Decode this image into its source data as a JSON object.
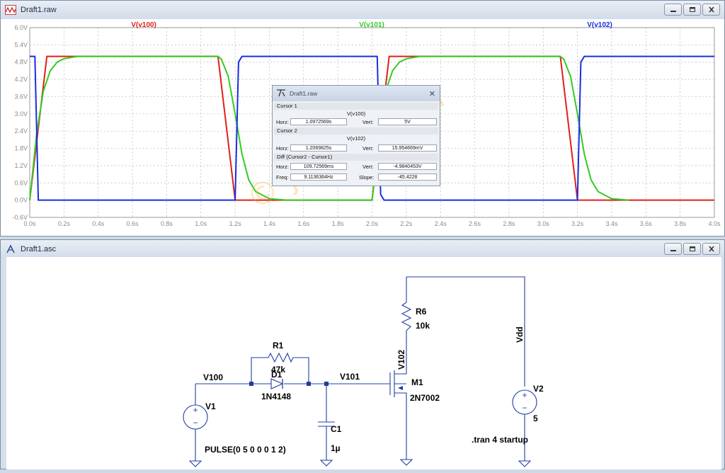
{
  "top_window": {
    "title": "Draft1.raw"
  },
  "bottom_window": {
    "title": "Draft1.asc"
  },
  "plot": {
    "trace_labels": [
      {
        "name": "V(v100)",
        "color": "#e0201a"
      },
      {
        "name": "V(v101)",
        "color": "#33cc22"
      },
      {
        "name": "V(v102)",
        "color": "#1a2de0"
      }
    ],
    "y_ticks": [
      "6.0V",
      "5.4V",
      "4.8V",
      "4.2V",
      "3.6V",
      "3.0V",
      "2.4V",
      "1.8V",
      "1.2V",
      "0.6V",
      "0.0V",
      "-0.6V"
    ],
    "x_ticks": [
      "0.0s",
      "0.2s",
      "0.4s",
      "0.6s",
      "0.8s",
      "1.0s",
      "1.2s",
      "1.4s",
      "1.6s",
      "1.8s",
      "2.0s",
      "2.2s",
      "2.4s",
      "2.6s",
      "2.8s",
      "3.0s",
      "3.2s",
      "3.4s",
      "3.6s",
      "3.8s",
      "4.0s"
    ],
    "watermark": "© jh4vaj.com"
  },
  "chart_data": {
    "type": "line",
    "xlabel": "",
    "ylabel": "",
    "xlim": [
      0,
      4.0
    ],
    "ylim": [
      -0.6,
      6.0
    ],
    "grid": true,
    "series": [
      {
        "name": "V(v100)",
        "color": "#e0201a",
        "x": [
          0,
          0.1,
          1.1,
          1.2,
          2.0,
          2.1,
          3.1,
          3.2,
          4.0
        ],
        "y": [
          0,
          5,
          5,
          0,
          0,
          5,
          5,
          0,
          0
        ]
      },
      {
        "name": "V(v101)",
        "color": "#33cc22",
        "x": [
          0,
          0.04,
          0.08,
          0.12,
          0.16,
          0.2,
          0.28,
          1.1,
          1.12,
          1.16,
          1.2,
          1.24,
          1.28,
          1.32,
          1.4,
          1.5,
          2.0,
          2.04,
          2.08,
          2.12,
          2.16,
          2.2,
          2.28,
          3.1,
          3.12,
          3.16,
          3.2,
          3.24,
          3.28,
          3.32,
          3.4,
          3.5
        ],
        "y": [
          0,
          2.3,
          3.8,
          4.5,
          4.8,
          4.92,
          5.0,
          5.0,
          4.9,
          4.3,
          3.0,
          1.6,
          0.7,
          0.3,
          0.05,
          0.0,
          0.0,
          2.3,
          3.8,
          4.5,
          4.8,
          4.92,
          5.0,
          5.0,
          4.9,
          4.3,
          3.0,
          1.6,
          0.7,
          0.3,
          0.05,
          0.0
        ]
      },
      {
        "name": "V(v102)",
        "color": "#1a2de0",
        "x": [
          0,
          0.01,
          0.03,
          0.05,
          1.2,
          1.22,
          1.24,
          2.03,
          2.05,
          2.07,
          3.2,
          3.22,
          3.24,
          4.0
        ],
        "y": [
          5,
          5,
          5,
          0,
          0,
          4.8,
          5,
          5,
          0.2,
          0,
          0,
          4.8,
          5,
          5
        ]
      }
    ]
  },
  "cursor_dialog": {
    "title": "Draft1.raw",
    "cursor1_label": "Cursor 1",
    "cursor1_trace": "V(v100)",
    "cursor1_horz_label": "Horz:",
    "cursor1_horz": "1.0972569s",
    "cursor1_vert_label": "Vert:",
    "cursor1_vert": "5V",
    "cursor2_label": "Cursor 2",
    "cursor2_trace": "V(v102)",
    "cursor2_horz_label": "Horz:",
    "cursor2_horz": "1.2069825s",
    "cursor2_vert_label": "Vert:",
    "cursor2_vert": "15.954669mV",
    "diff_label": "Diff (Cursor2 - Cursor1)",
    "diff_horz_label": "Horz:",
    "diff_horz": "109.72569ms",
    "diff_vert_label": "Vert:",
    "diff_vert": "-4.9840453V",
    "freq_label": "Freq:",
    "freq": "9.1136364Hz",
    "slope_label": "Slope:",
    "slope": "-45.4228"
  },
  "schematic": {
    "r1_name": "R1",
    "r1_value": "47k",
    "d1_name": "D1",
    "d1_model": "1N4148",
    "net_v100": "V100",
    "net_v101": "V101",
    "net_v102": "V102",
    "net_vdd": "Vdd",
    "v1_name": "V1",
    "v1_value": "PULSE(0 5 0 0 0 1 2)",
    "c1_name": "C1",
    "c1_value": "1µ",
    "m1_name": "M1",
    "m1_model": "2N7002",
    "r6_name": "R6",
    "r6_value": "10k",
    "v2_name": "V2",
    "v2_value": "5",
    "directive": ".tran 4 startup"
  }
}
